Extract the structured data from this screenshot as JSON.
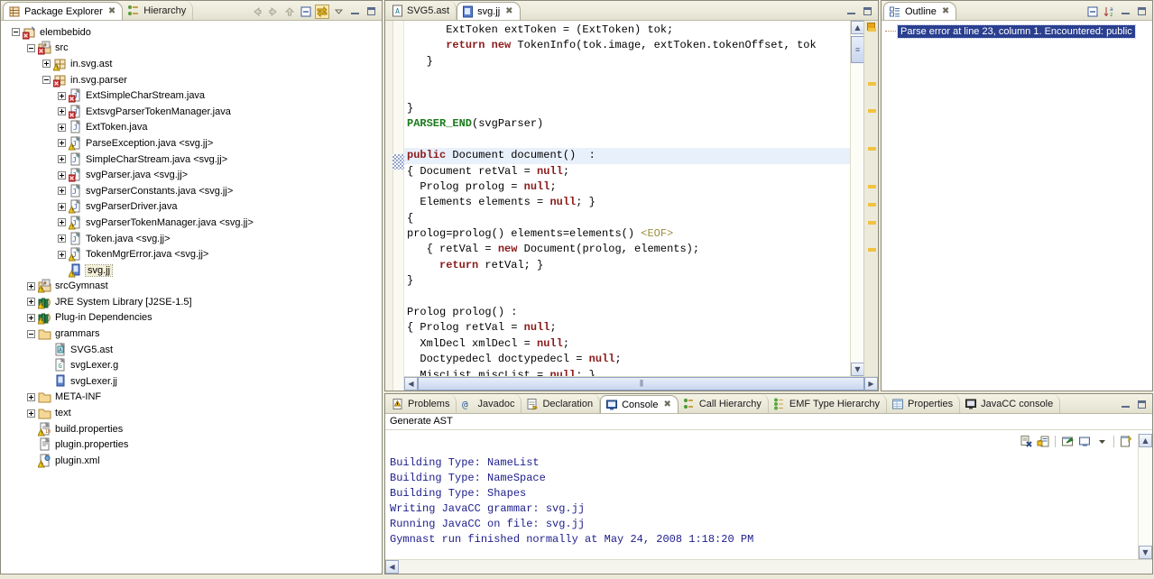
{
  "package_explorer": {
    "tabs": [
      {
        "label": "Package Explorer",
        "icon": "package-explorer-icon",
        "active": true,
        "closable": true
      },
      {
        "label": "Hierarchy",
        "icon": "hierarchy-icon",
        "active": false,
        "closable": false
      }
    ],
    "toolbar": [
      {
        "name": "back-button",
        "icon": "arrow-left-icon"
      },
      {
        "name": "forward-button",
        "icon": "arrow-right-icon"
      },
      {
        "name": "up-button",
        "icon": "arrow-up-icon"
      },
      {
        "name": "collapse-all-button",
        "icon": "collapse-all-icon"
      },
      {
        "name": "link-with-editor-button",
        "icon": "link-editor-icon",
        "selected": true
      },
      {
        "name": "view-menu-button",
        "icon": "chevron-down-icon"
      },
      {
        "name": "minimize-button",
        "icon": "minimize-icon"
      },
      {
        "name": "maximize-button",
        "icon": "maximize-icon"
      }
    ],
    "tree": [
      {
        "label": "elembebido",
        "depth": 0,
        "expander": "minus",
        "icon": "java-project-icon",
        "selected": false
      },
      {
        "label": "src",
        "depth": 1,
        "expander": "minus",
        "icon": "source-folder-icon",
        "selected": false
      },
      {
        "label": "in.svg.ast",
        "depth": 2,
        "expander": "plus",
        "icon": "package-warning-icon",
        "selected": false
      },
      {
        "label": "in.svg.parser",
        "depth": 2,
        "expander": "minus",
        "icon": "package-error-icon",
        "selected": false
      },
      {
        "label": "ExtSimpleCharStream.java",
        "depth": 3,
        "expander": "plus",
        "icon": "java-file-error-icon",
        "selected": false
      },
      {
        "label": "ExtsvgParserTokenManager.java",
        "depth": 3,
        "expander": "plus",
        "icon": "java-file-error-icon",
        "selected": false
      },
      {
        "label": "ExtToken.java",
        "depth": 3,
        "expander": "plus",
        "icon": "java-file-icon",
        "selected": false
      },
      {
        "label": "ParseException.java <svg.jj>",
        "depth": 3,
        "expander": "plus",
        "icon": "java-gen-warning-icon",
        "selected": false
      },
      {
        "label": "SimpleCharStream.java <svg.jj>",
        "depth": 3,
        "expander": "plus",
        "icon": "java-gen-icon",
        "selected": false
      },
      {
        "label": "svgParser.java <svg.jj>",
        "depth": 3,
        "expander": "plus",
        "icon": "java-gen-error-icon",
        "selected": false
      },
      {
        "label": "svgParserConstants.java <svg.jj>",
        "depth": 3,
        "expander": "plus",
        "icon": "java-gen-icon",
        "selected": false
      },
      {
        "label": "svgParserDriver.java",
        "depth": 3,
        "expander": "plus",
        "icon": "java-file-warning-icon",
        "selected": false
      },
      {
        "label": "svgParserTokenManager.java <svg.jj>",
        "depth": 3,
        "expander": "plus",
        "icon": "java-gen-warning-icon",
        "selected": false
      },
      {
        "label": "Token.java <svg.jj>",
        "depth": 3,
        "expander": "plus",
        "icon": "java-gen-icon",
        "selected": false
      },
      {
        "label": "TokenMgrError.java <svg.jj>",
        "depth": 3,
        "expander": "plus",
        "icon": "java-gen-warning-icon",
        "selected": false
      },
      {
        "label": "svg.jj",
        "depth": 3,
        "expander": "none",
        "icon": "jj-file-warning-icon",
        "selected": true
      },
      {
        "label": "srcGymnast",
        "depth": 1,
        "expander": "plus",
        "icon": "source-folder-warning-icon",
        "selected": false
      },
      {
        "label": "JRE System Library [J2SE-1.5]",
        "depth": 1,
        "expander": "plus",
        "icon": "library-icon",
        "selected": false
      },
      {
        "label": "Plug-in Dependencies",
        "depth": 1,
        "expander": "plus",
        "icon": "library-icon",
        "selected": false
      },
      {
        "label": "grammars",
        "depth": 1,
        "expander": "minus",
        "icon": "folder-icon",
        "selected": false
      },
      {
        "label": "SVG5.ast",
        "depth": 2,
        "expander": "none",
        "icon": "ast-file-icon",
        "selected": false
      },
      {
        "label": "svgLexer.g",
        "depth": 2,
        "expander": "none",
        "icon": "g-file-icon",
        "selected": false
      },
      {
        "label": "svgLexer.jj",
        "depth": 2,
        "expander": "none",
        "icon": "jj-file-icon",
        "selected": false
      },
      {
        "label": "META-INF",
        "depth": 1,
        "expander": "plus",
        "icon": "folder-icon",
        "selected": false
      },
      {
        "label": "text",
        "depth": 1,
        "expander": "plus",
        "icon": "folder-icon",
        "selected": false
      },
      {
        "label": "build.properties",
        "depth": 1,
        "expander": "none",
        "icon": "properties-warning-icon",
        "selected": false
      },
      {
        "label": "plugin.properties",
        "depth": 1,
        "expander": "none",
        "icon": "properties-icon",
        "selected": false
      },
      {
        "label": "plugin.xml",
        "depth": 1,
        "expander": "none",
        "icon": "plugin-xml-warning-icon",
        "selected": false
      }
    ]
  },
  "editor": {
    "tabs": [
      {
        "label": "SVG5.ast",
        "icon": "ast-file-icon",
        "active": false,
        "closable": false
      },
      {
        "label": "svg.jj",
        "icon": "jj-file-icon",
        "active": true,
        "closable": true
      }
    ],
    "toolbar": [
      {
        "name": "minimize-button",
        "icon": "minimize-icon"
      },
      {
        "name": "maximize-button",
        "icon": "maximize-icon"
      }
    ],
    "lines": [
      {
        "highlight": false,
        "spans": [
          {
            "t": "      ExtToken extToken = (ExtToken) tok;",
            "c": "plain"
          }
        ]
      },
      {
        "highlight": false,
        "spans": [
          {
            "t": "      ",
            "c": "plain"
          },
          {
            "t": "return new",
            "c": "kw"
          },
          {
            "t": " TokenInfo(tok.image, extToken.tokenOffset, tok",
            "c": "plain"
          }
        ]
      },
      {
        "highlight": false,
        "spans": [
          {
            "t": "   }",
            "c": "plain"
          }
        ]
      },
      {
        "highlight": false,
        "spans": [
          {
            "t": "",
            "c": "plain"
          }
        ]
      },
      {
        "highlight": false,
        "spans": [
          {
            "t": "",
            "c": "plain"
          }
        ]
      },
      {
        "highlight": false,
        "spans": [
          {
            "t": "}",
            "c": "plain"
          }
        ]
      },
      {
        "highlight": false,
        "spans": [
          {
            "t": "PARSER_END",
            "c": "kw2"
          },
          {
            "t": "(svgParser)",
            "c": "plain"
          }
        ]
      },
      {
        "highlight": false,
        "spans": [
          {
            "t": "",
            "c": "plain"
          }
        ]
      },
      {
        "highlight": true,
        "spans": [
          {
            "t": "public",
            "c": "kw"
          },
          {
            "t": " Document document()  :",
            "c": "plain"
          }
        ]
      },
      {
        "highlight": false,
        "spans": [
          {
            "t": "{ Document retVal = ",
            "c": "plain"
          },
          {
            "t": "null",
            "c": "kw"
          },
          {
            "t": ";",
            "c": "plain"
          }
        ]
      },
      {
        "highlight": false,
        "spans": [
          {
            "t": "  Prolog prolog = ",
            "c": "plain"
          },
          {
            "t": "null",
            "c": "kw"
          },
          {
            "t": ";",
            "c": "plain"
          }
        ]
      },
      {
        "highlight": false,
        "spans": [
          {
            "t": "  Elements elements = ",
            "c": "plain"
          },
          {
            "t": "null",
            "c": "kw"
          },
          {
            "t": "; }",
            "c": "plain"
          }
        ]
      },
      {
        "highlight": false,
        "spans": [
          {
            "t": "{",
            "c": "plain"
          }
        ]
      },
      {
        "highlight": false,
        "spans": [
          {
            "t": "prolog=prolog() elements=elements() ",
            "c": "plain"
          },
          {
            "t": "<EOF>",
            "c": "tok"
          }
        ]
      },
      {
        "highlight": false,
        "spans": [
          {
            "t": "   { retVal = ",
            "c": "plain"
          },
          {
            "t": "new",
            "c": "kw"
          },
          {
            "t": " Document(prolog, elements);",
            "c": "plain"
          }
        ]
      },
      {
        "highlight": false,
        "spans": [
          {
            "t": "     ",
            "c": "plain"
          },
          {
            "t": "return",
            "c": "kw"
          },
          {
            "t": " retVal; }",
            "c": "plain"
          }
        ]
      },
      {
        "highlight": false,
        "spans": [
          {
            "t": "}",
            "c": "plain"
          }
        ]
      },
      {
        "highlight": false,
        "spans": [
          {
            "t": "",
            "c": "plain"
          }
        ]
      },
      {
        "highlight": false,
        "spans": [
          {
            "t": "Prolog prolog() :",
            "c": "plain"
          }
        ]
      },
      {
        "highlight": false,
        "spans": [
          {
            "t": "{ Prolog retVal = ",
            "c": "plain"
          },
          {
            "t": "null",
            "c": "kw"
          },
          {
            "t": ";",
            "c": "plain"
          }
        ]
      },
      {
        "highlight": false,
        "spans": [
          {
            "t": "  XmlDecl xmlDecl = ",
            "c": "plain"
          },
          {
            "t": "null",
            "c": "kw"
          },
          {
            "t": ";",
            "c": "plain"
          }
        ]
      },
      {
        "highlight": false,
        "spans": [
          {
            "t": "  Doctypedecl doctypedecl = ",
            "c": "plain"
          },
          {
            "t": "null",
            "c": "kw"
          },
          {
            "t": ";",
            "c": "plain"
          }
        ]
      },
      {
        "highlight": false,
        "spans": [
          {
            "t": "  MiscList miscList = ",
            "c": "plain"
          },
          {
            "t": "null",
            "c": "kw"
          },
          {
            "t": "; }",
            "c": "plain"
          }
        ]
      },
      {
        "highlight": false,
        "spans": [
          {
            "t": "{",
            "c": "plain"
          }
        ]
      }
    ],
    "annotation_markers": [
      8,
      68,
      98,
      140,
      182,
      202,
      222,
      252
    ]
  },
  "outline": {
    "tabs": [
      {
        "label": "Outline",
        "icon": "outline-icon",
        "active": true,
        "closable": true
      }
    ],
    "toolbar": [
      {
        "name": "collapse-all-button",
        "icon": "collapse-all-icon"
      },
      {
        "name": "sort-button",
        "icon": "sort-az-icon"
      },
      {
        "name": "minimize-button",
        "icon": "minimize-icon"
      },
      {
        "name": "maximize-button",
        "icon": "maximize-icon"
      }
    ],
    "message": "Parse error at line 23, column 1.  Encountered: public"
  },
  "console": {
    "tabs": [
      {
        "label": "Problems",
        "icon": "problems-icon",
        "active": false,
        "closable": false
      },
      {
        "label": "Javadoc",
        "icon": "javadoc-icon",
        "active": false,
        "closable": false
      },
      {
        "label": "Declaration",
        "icon": "declaration-icon",
        "active": false,
        "closable": false
      },
      {
        "label": "Console",
        "icon": "console-icon",
        "active": true,
        "closable": true
      },
      {
        "label": "Call Hierarchy",
        "icon": "call-hierarchy-icon",
        "active": false,
        "closable": false
      },
      {
        "label": "EMF Type Hierarchy",
        "icon": "emf-hierarchy-icon",
        "active": false,
        "closable": false
      },
      {
        "label": "Properties",
        "icon": "properties-view-icon",
        "active": false,
        "closable": false
      },
      {
        "label": "JavaCC console",
        "icon": "javacc-console-icon",
        "active": false,
        "closable": false
      }
    ],
    "toolbar": [
      {
        "name": "clear-console-button",
        "icon": "clear-console-icon"
      },
      {
        "name": "scroll-lock-button",
        "icon": "scroll-lock-icon"
      },
      {
        "name": "pin-console-button",
        "icon": "pin-console-icon"
      },
      {
        "name": "display-selected-console-button",
        "icon": "display-console-icon"
      },
      {
        "name": "display-dropdown-button",
        "icon": "chevron-down-icon"
      },
      {
        "name": "open-console-button",
        "icon": "open-console-icon"
      },
      {
        "name": "open-console-dropdown-button",
        "icon": "chevron-down-icon"
      }
    ],
    "title": "Generate AST",
    "output": [
      "Building Type: NameList",
      "Building Type: NameSpace",
      "Building Type: Shapes",
      "Writing JavaCC grammar: svg.jj",
      "Running JavaCC on file: svg.jj",
      "Gymnast run finished normally at May 24, 2008 1:18:20 PM"
    ],
    "window_controls": [
      {
        "name": "minimize-button",
        "icon": "minimize-icon"
      },
      {
        "name": "maximize-button",
        "icon": "maximize-icon"
      }
    ]
  },
  "colors": {
    "keyword": "#8b1a1a",
    "parser_macro": "#1a7a1a",
    "token_ref": "#9b8f3c",
    "console_text": "#1c1c8c",
    "selection_bg": "#2a3f8f",
    "highlight_line": "#e8f0fb",
    "chrome_bg": "#ece9d8"
  }
}
